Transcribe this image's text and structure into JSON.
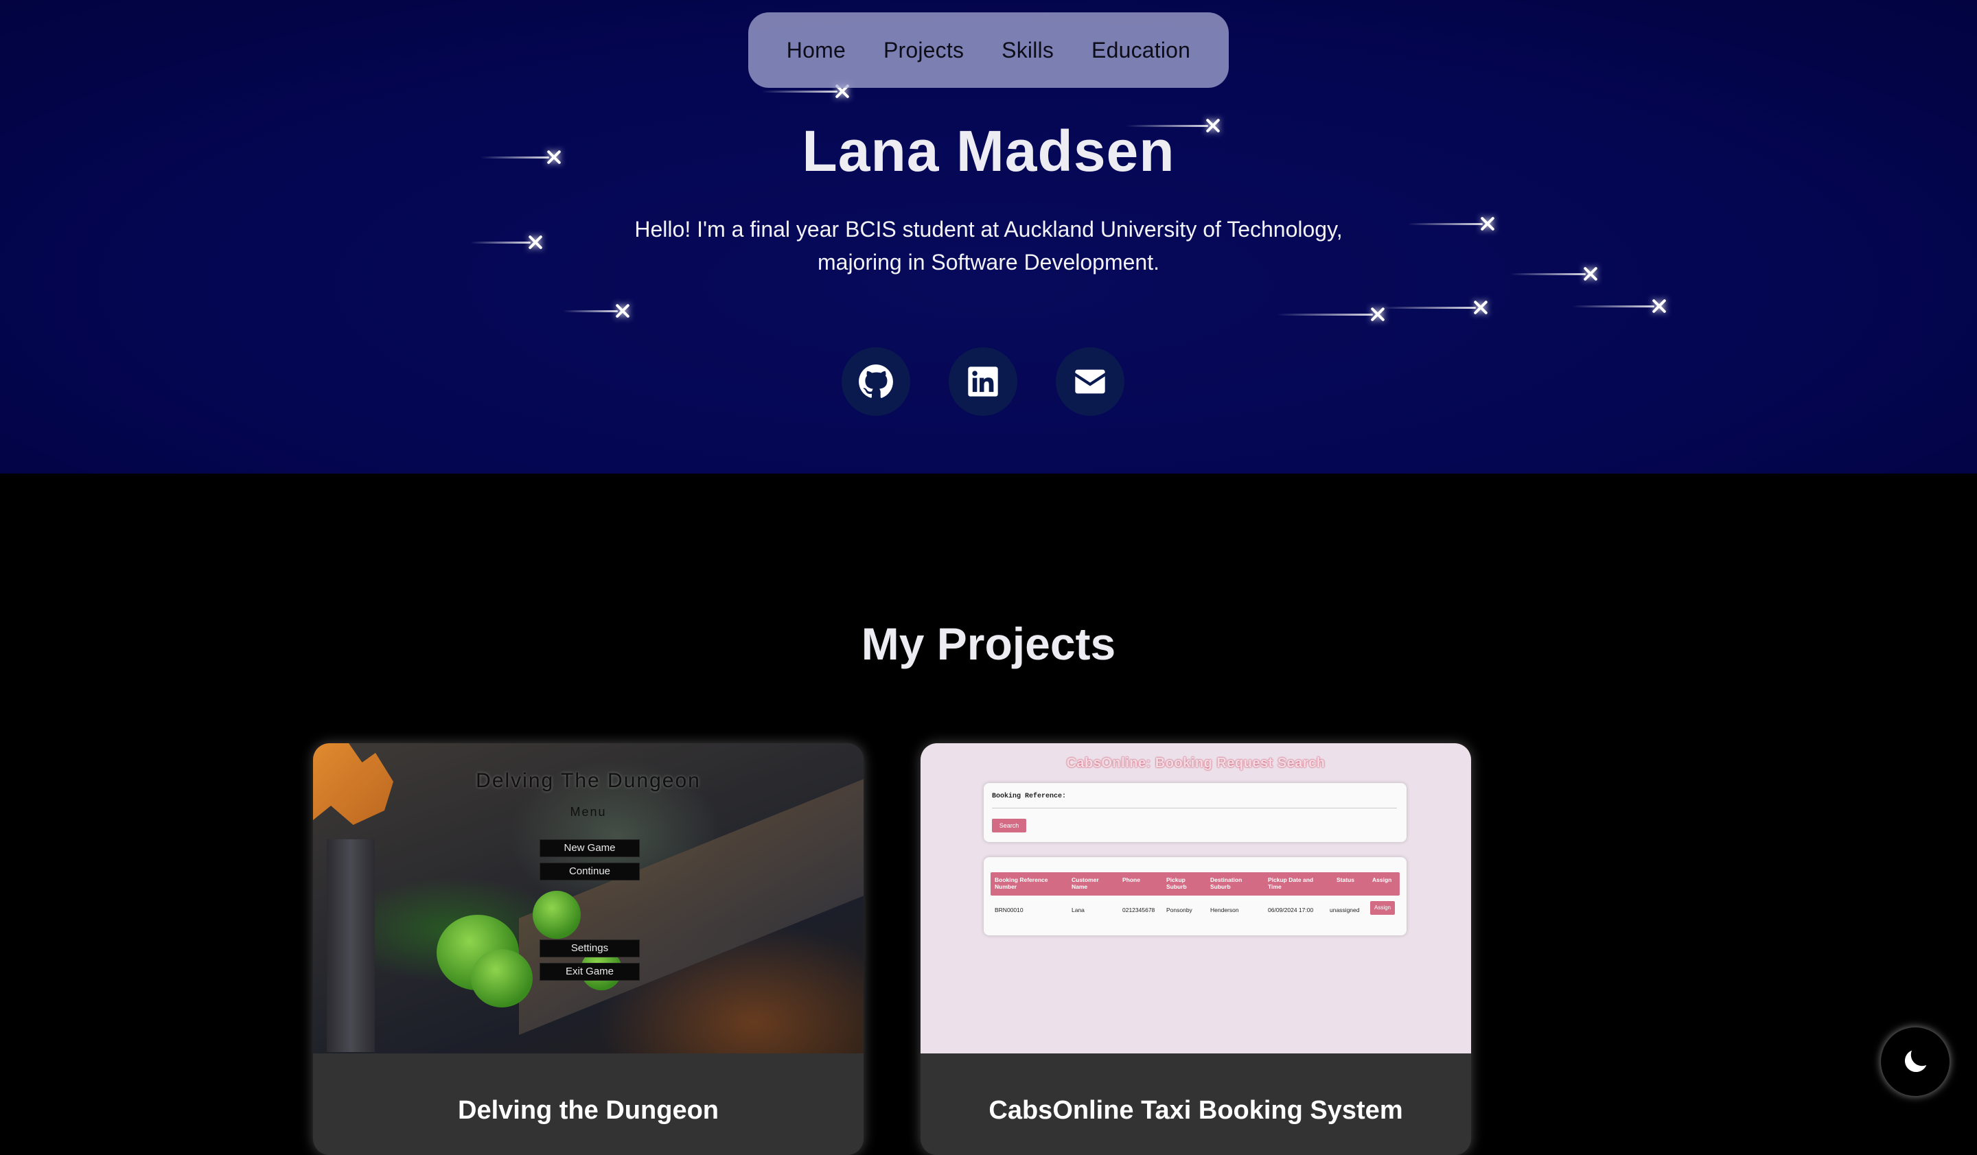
{
  "nav": {
    "items": [
      {
        "label": "Home"
      },
      {
        "label": "Projects"
      },
      {
        "label": "Skills"
      },
      {
        "label": "Education"
      }
    ]
  },
  "hero": {
    "name": "Lana Madsen",
    "intro_line1": "Hello! I'm a final year BCIS student at Auckland University of Technology,",
    "intro_line2": "majoring in Software Development.",
    "socials": [
      {
        "icon": "github-icon"
      },
      {
        "icon": "linkedin-icon"
      },
      {
        "icon": "email-icon"
      }
    ]
  },
  "projects": {
    "title": "My Projects",
    "cards": [
      {
        "title": "Delving the Dungeon",
        "screenshot": {
          "game_title": "Delving The Dungeon",
          "menu_label": "Menu",
          "buttons": [
            "New Game",
            "Continue",
            "Settings",
            "Exit Game"
          ]
        }
      },
      {
        "title": "CabsOnline Taxi Booking System",
        "screenshot": {
          "page_title": "CabsOnline: Booking Request Search",
          "field_label": "Booking Reference:",
          "search_label": "Search",
          "columns": [
            "Booking Reference Number",
            "Customer Name",
            "Phone",
            "Pickup Suburb",
            "Destination Suburb",
            "Pickup Date and Time",
            "Status",
            "Assign"
          ],
          "row": [
            "BRN00010",
            "Lana",
            "0212345678",
            "Ponsonby",
            "Henderson",
            "06/09/2024 17:00",
            "unassigned"
          ],
          "assign_label": "Assign"
        }
      }
    ]
  },
  "theme_toggle": {
    "icon": "moon-icon"
  },
  "colors": {
    "hero_bg": "#040653",
    "nav_bg": "#aaafd7",
    "social_bg": "#0a1a4f",
    "card_body": "#333333",
    "cabs_accent": "#d46b84"
  }
}
